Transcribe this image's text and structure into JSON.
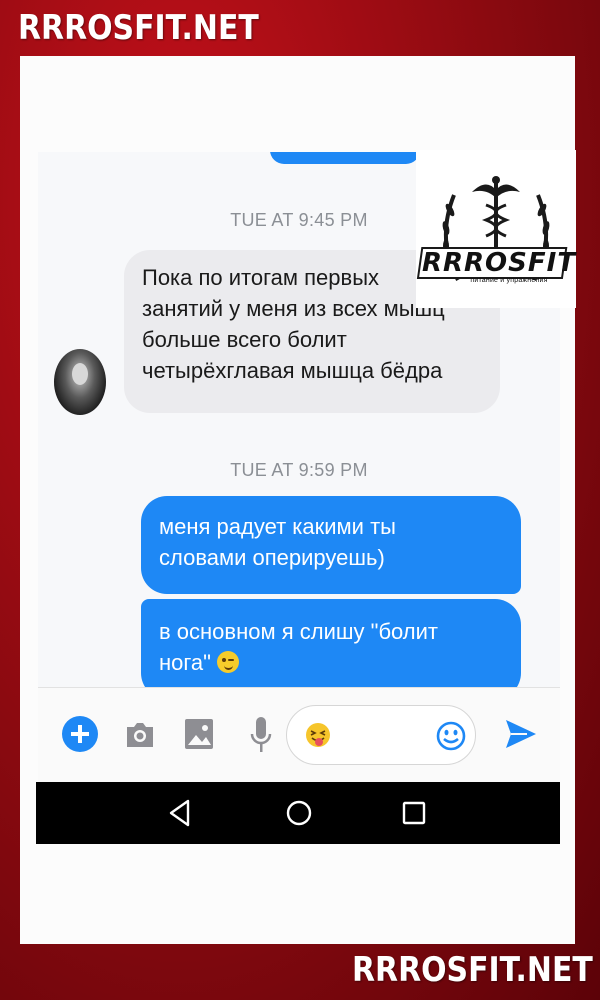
{
  "watermark": {
    "top": "RRROSFIT.NET",
    "bottom": "RRROSFIT.NET"
  },
  "logo": {
    "name": "RRROSFIT",
    "tagline": "питание и упражнения"
  },
  "chat": {
    "messages": [
      {
        "type": "timestamp",
        "text": "TUE AT 9:45 PM"
      },
      {
        "type": "incoming",
        "lines": [
          "Пока по итогам первых",
          "занятий у  меня из всех мышц",
          "больше всего болит",
          "четырёхглавая мышца бёдра"
        ]
      },
      {
        "type": "timestamp",
        "text": "TUE AT 9:59 PM"
      },
      {
        "type": "outgoing",
        "lines": [
          "меня радует какими ты",
          "словами оперируешь)"
        ]
      },
      {
        "type": "outgoing",
        "lines": [
          "в основном я слишу \"болит",
          "нога\""
        ],
        "emoji": "winking-face"
      }
    ]
  },
  "composer": {
    "icons": [
      "plus-icon",
      "camera-icon",
      "image-icon",
      "microphone-icon",
      "tongue-out-emoji",
      "smiley-icon",
      "send-icon"
    ],
    "accent_color": "#1e88f5"
  },
  "navbar": {
    "icons": [
      "back-icon",
      "home-icon",
      "recents-icon"
    ]
  }
}
